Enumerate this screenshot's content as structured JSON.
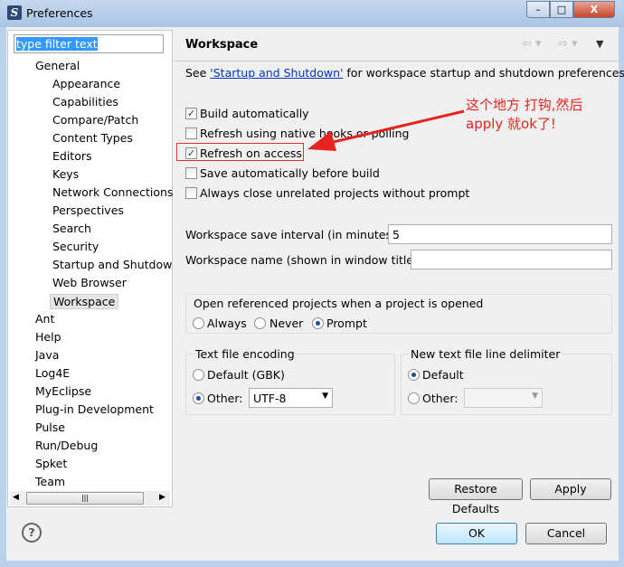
{
  "window": {
    "title": "Preferences",
    "minimize": "–",
    "maximize": "□",
    "close": "X"
  },
  "filter": {
    "value": "type filter text"
  },
  "tree": [
    {
      "label": "General",
      "level": 0
    },
    {
      "label": "Appearance",
      "level": 1
    },
    {
      "label": "Capabilities",
      "level": 1
    },
    {
      "label": "Compare/Patch",
      "level": 1
    },
    {
      "label": "Content Types",
      "level": 1
    },
    {
      "label": "Editors",
      "level": 1
    },
    {
      "label": "Keys",
      "level": 1
    },
    {
      "label": "Network Connections",
      "level": 1
    },
    {
      "label": "Perspectives",
      "level": 1
    },
    {
      "label": "Search",
      "level": 1
    },
    {
      "label": "Security",
      "level": 1
    },
    {
      "label": "Startup and Shutdow",
      "level": 1
    },
    {
      "label": "Web Browser",
      "level": 1
    },
    {
      "label": "Workspace",
      "level": 1,
      "selected": true
    },
    {
      "label": "Ant",
      "level": 0
    },
    {
      "label": "Help",
      "level": 0
    },
    {
      "label": "Java",
      "level": 0
    },
    {
      "label": "Log4E",
      "level": 0
    },
    {
      "label": "MyEclipse",
      "level": 0
    },
    {
      "label": "Plug-in Development",
      "level": 0
    },
    {
      "label": "Pulse",
      "level": 0
    },
    {
      "label": "Run/Debug",
      "level": 0
    },
    {
      "label": "Spket",
      "level": 0
    },
    {
      "label": "Team",
      "level": 0
    }
  ],
  "page": {
    "title": "Workspace",
    "see_prefix": "See ",
    "see_link": "'Startup and Shutdown'",
    "see_suffix": " for workspace startup and shutdown preferences.",
    "checkboxes": [
      {
        "label": "Build automatically",
        "checked": true
      },
      {
        "label": "Refresh using native hooks or polling",
        "checked": false
      },
      {
        "label": "Refresh on access",
        "checked": true
      },
      {
        "label": "Save automatically before build",
        "checked": false
      },
      {
        "label": "Always close unrelated projects without prompt",
        "checked": false
      }
    ],
    "save_interval_label": "Workspace save interval (in minutes):",
    "save_interval_value": "5",
    "workspace_name_label": "Workspace name (shown in window title):",
    "workspace_name_value": "",
    "open_ref": {
      "label": "Open referenced projects when a project is opened",
      "options": [
        "Always",
        "Never",
        "Prompt"
      ],
      "selected": "Prompt"
    },
    "encoding": {
      "label": "Text file encoding",
      "default": "Default (GBK)",
      "other": "Other:",
      "other_value": "UTF-8",
      "selected": "Other"
    },
    "delimiter": {
      "label": "New text file line delimiter",
      "default": "Default",
      "other": "Other:",
      "selected": "Default"
    },
    "restore_defaults": "Restore Defaults",
    "apply": "Apply"
  },
  "annotation": {
    "line1": "这个地方 打钩,然后",
    "line2": "apply 就ok了!",
    "color": "#e8231f"
  },
  "footer": {
    "help": "?",
    "ok": "OK",
    "cancel": "Cancel"
  }
}
